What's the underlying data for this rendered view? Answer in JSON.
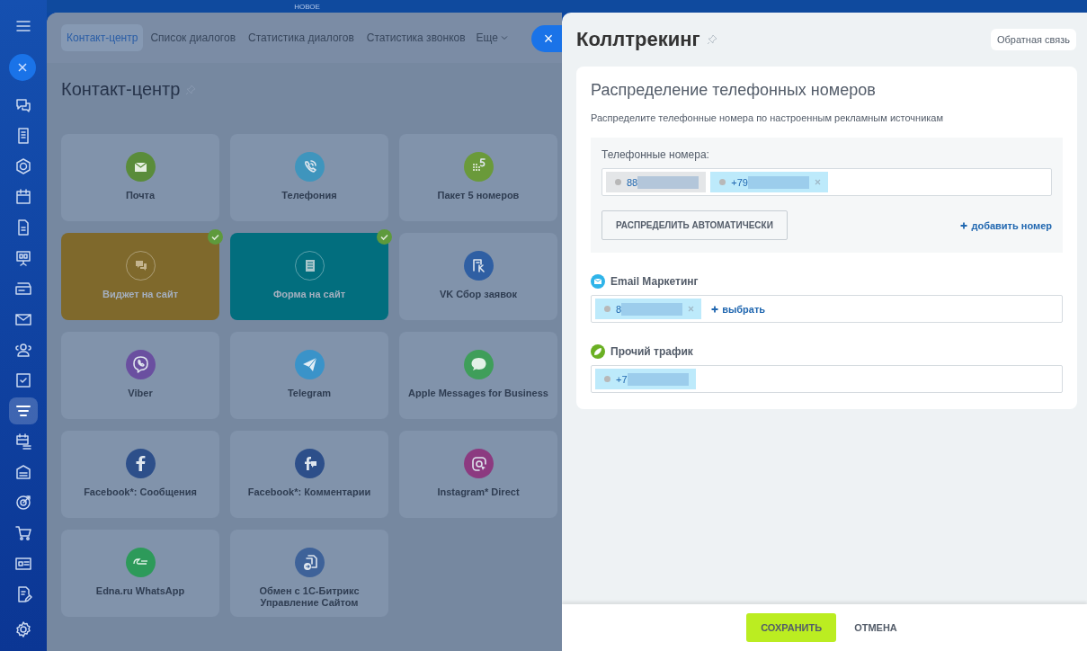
{
  "top_badge": "НОВОЕ",
  "sidebar": {
    "items": [
      {
        "selected": false
      },
      {
        "selected": false
      },
      {
        "selected": false
      },
      {
        "selected": false
      },
      {
        "selected": false
      },
      {
        "selected": false
      },
      {
        "selected": false
      },
      {
        "selected": false
      },
      {
        "selected": false
      },
      {
        "selected": false
      },
      {
        "selected": true
      },
      {
        "selected": false
      },
      {
        "selected": false
      },
      {
        "selected": false
      },
      {
        "selected": false
      },
      {
        "selected": false
      },
      {
        "selected": false
      }
    ]
  },
  "background_page": {
    "tabs": [
      {
        "label": "Контакт-центр",
        "selected": true
      },
      {
        "label": "Список диалогов",
        "selected": false
      },
      {
        "label": "Статистика диалогов",
        "selected": false
      },
      {
        "label": "Статистика звонков",
        "selected": false
      }
    ],
    "more_tab": "Еще",
    "close": "×",
    "title": "Контакт-центр",
    "cards": [
      {
        "label": "Почта",
        "kind": "mail",
        "color": "#5a8c3a",
        "connected": false
      },
      {
        "label": "Телефония",
        "kind": "phone",
        "color": "#3f95bd",
        "connected": false
      },
      {
        "label": "Пакет 5 номеров",
        "kind": "pack",
        "color": "#6a9a3a",
        "connected": false
      },
      {
        "label": "Виджет на сайт",
        "kind": "chat",
        "color": "#7f692c",
        "connected": true
      },
      {
        "label": "Форма на сайт",
        "kind": "form",
        "color": "#026e7e",
        "connected": true
      },
      {
        "label": "VK Сбор заявок",
        "kind": "vk",
        "color": "#2f5fa3",
        "connected": false
      },
      {
        "label": "Viber",
        "kind": "viber",
        "color": "#6a4fa0",
        "connected": false
      },
      {
        "label": "Telegram",
        "kind": "plane",
        "color": "#3a93c9",
        "connected": false
      },
      {
        "label": "Apple Messages for Business",
        "kind": "bubble",
        "color": "#3f9e5a",
        "connected": false
      },
      {
        "label": "Facebook*: Сообщения",
        "kind": "fb",
        "color": "#2d4f8a",
        "connected": false
      },
      {
        "label": "Facebook*: Комментарии",
        "kind": "fbchat",
        "color": "#2d4f8a",
        "connected": false
      },
      {
        "label": "Instagram* Direct",
        "kind": "insta",
        "color": "#8c3a80",
        "connected": false
      },
      {
        "label": "Edna.ru WhatsApp",
        "kind": "edna",
        "color": "#2d9a5a",
        "connected": false
      },
      {
        "label": "Обмен с 1С-Битрикс Управление Сайтом",
        "kind": "exchange",
        "color": "#3e6299",
        "connected": false
      }
    ]
  },
  "panel": {
    "title": "Коллтрекинг",
    "feedback_button": "Обратная связь",
    "section_title": "Распределение телефонных номеров",
    "description": "Распределите телефонные номера по настроенным рекламным источникам",
    "numbers_label": "Телефонные номера:",
    "numbers": [
      {
        "text": "88",
        "assigned": false,
        "removable": false
      },
      {
        "text": "+79",
        "assigned": true,
        "removable": true
      }
    ],
    "auto_button": "РАСПРЕДЕЛИТЬ АВТОМАТИЧЕСКИ",
    "add_link": "добавить номер",
    "sources": [
      {
        "name": "Email Маркетинг",
        "kind": "email",
        "color": "#2fb4e9",
        "numbers": [
          {
            "text": "8",
            "assigned": true,
            "removable": true
          }
        ],
        "select_link": "выбрать"
      },
      {
        "name": "Прочий трафик",
        "kind": "other",
        "color": "#6ab023",
        "numbers": [
          {
            "text": "+7",
            "assigned": true,
            "removable": false
          }
        ]
      }
    ]
  },
  "footer": {
    "save": "СОХРАНИТЬ",
    "cancel": "ОТМЕНА"
  }
}
